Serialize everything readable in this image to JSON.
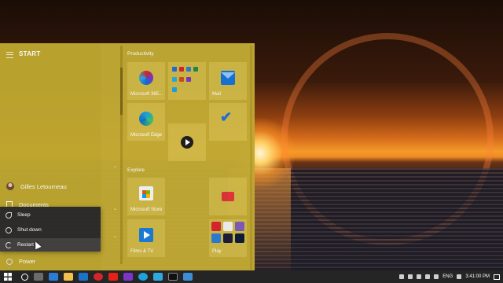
{
  "start_menu": {
    "title": "START",
    "user_name": "Gilles Letourneau",
    "documents_label": "Documents",
    "power_label": "Power",
    "power_options": [
      {
        "label": "Sleep",
        "icon": "moon-icon"
      },
      {
        "label": "Shut down",
        "icon": "power-icon"
      },
      {
        "label": "Restart",
        "icon": "restart-icon",
        "hovered": true
      }
    ]
  },
  "tiles": {
    "group_productivity": "Productivity",
    "group_explore": "Explore",
    "items": [
      {
        "label": "Microsoft 365...",
        "icon": "office-icon"
      },
      {
        "label": "",
        "icon": "office-apps-folder-icon"
      },
      {
        "label": "Mail",
        "icon": "mail-icon"
      },
      {
        "label": "Microsoft Edge",
        "icon": "edge-icon"
      },
      {
        "label": "",
        "icon": "media-player-icon"
      },
      {
        "label": "",
        "icon": "todo-icon"
      },
      {
        "label": "Microsoft Store",
        "icon": "store-icon"
      },
      {
        "label": "",
        "icon": "news-icon"
      },
      {
        "label": "Films & TV",
        "icon": "films-tv-icon"
      },
      {
        "label": "Play",
        "icon": "play-folder-icon"
      }
    ]
  },
  "taskbar": {
    "language": "ENG",
    "time": "3:41:00 PM",
    "accent_color": "#c1a934"
  }
}
